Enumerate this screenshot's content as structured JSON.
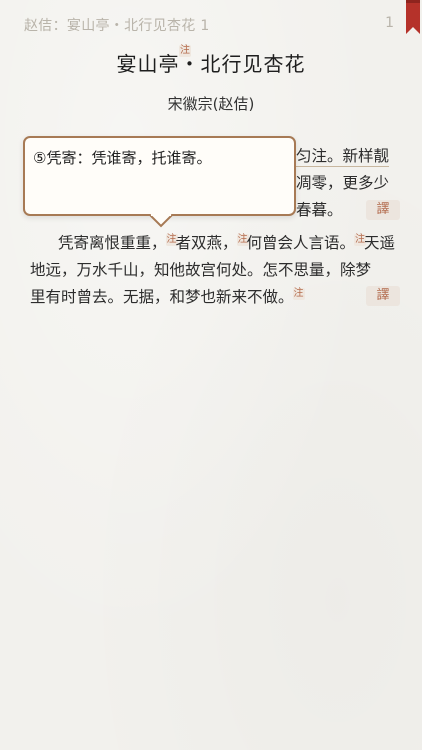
{
  "header": {
    "breadcrumb": "赵佶：宴山亭・北行见杏花 1",
    "page_number": "1"
  },
  "poem": {
    "title": "宴山亭・北行见杏花",
    "author": "宋徽宗(赵佶)",
    "note_marker": "注",
    "translate_label": "譯",
    "lines": {
      "l1_visible": "匀注。新样靓",
      "l2_visible": "凋零，更多少",
      "l3_visible": "春暮。",
      "l4_a": "凭寄离恨重重，",
      "l4_b": "者双燕，",
      "l4_c": "何曾会人言语。",
      "l4_d": "天遥",
      "l5": "地远，万水千山，知他故宫何处。怎不思量，除梦",
      "l6_a": "里有时曾去。无据，",
      "l6_b": "和梦也新来不做。"
    }
  },
  "popover": {
    "text": "⑤凭寄：凭谁寄，托谁寄。"
  },
  "colors": {
    "accent": "#b36b4d",
    "popover_border": "#a77a55",
    "bookmark": "#c0392b"
  }
}
